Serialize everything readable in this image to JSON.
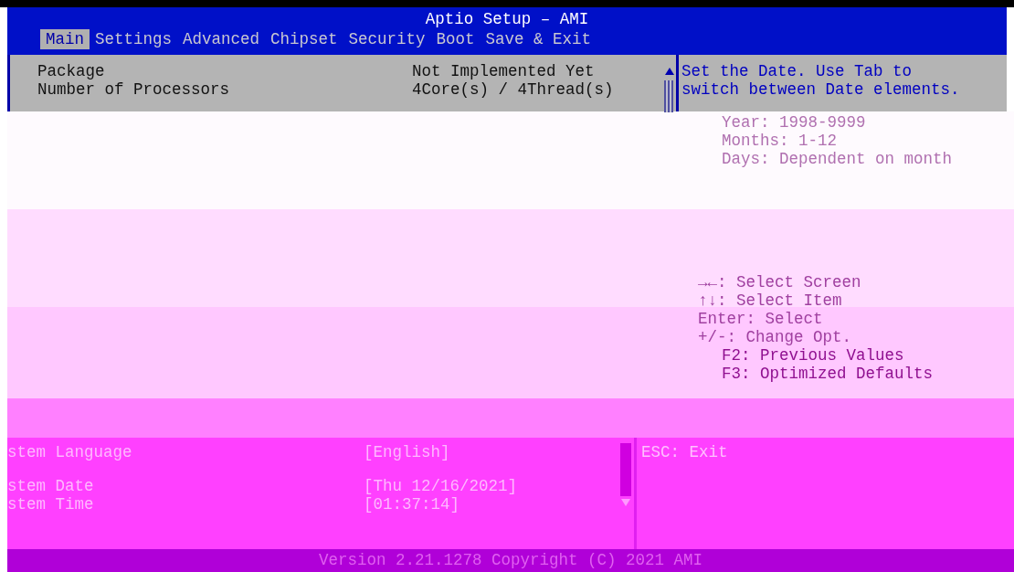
{
  "window": {
    "title": "Aptio Setup – AMI"
  },
  "tabs": [
    {
      "label": "Main",
      "selected": true
    },
    {
      "label": "Settings",
      "selected": false
    },
    {
      "label": "Advanced",
      "selected": false
    },
    {
      "label": "Chipset",
      "selected": false
    },
    {
      "label": "Security",
      "selected": false
    },
    {
      "label": "Boot",
      "selected": false
    },
    {
      "label": "Save & Exit",
      "selected": false
    }
  ],
  "items": [
    {
      "label": "Package",
      "value": "Not Implemented Yet"
    },
    {
      "label": "Number of Processors",
      "value": "4Core(s) / 4Thread(s)"
    }
  ],
  "help": [
    "Set the Date. Use Tab to",
    "switch between Date elements."
  ],
  "faded_help": [
    "Year: 1998-9999",
    "Months: 1-12",
    "Days: Dependent on month"
  ],
  "faded_keys": [
    "→←: Select Screen",
    "↑↓: Select Item",
    "Enter: Select",
    "+/-: Change Opt.",
    "F2: Previous Values",
    "F3: Optimized Defaults"
  ],
  "lower_items": [
    {
      "label": "stem Language",
      "value": "[English]"
    },
    {
      "label": "stem Date",
      "value": "[Thu 12/16/2021]"
    },
    {
      "label": "stem Time",
      "value": "[01:37:14]"
    }
  ],
  "lower_keys": [
    "ESC: Exit"
  ],
  "footer": "Version 2.21.1278 Copyright (C) 2021 AMI"
}
